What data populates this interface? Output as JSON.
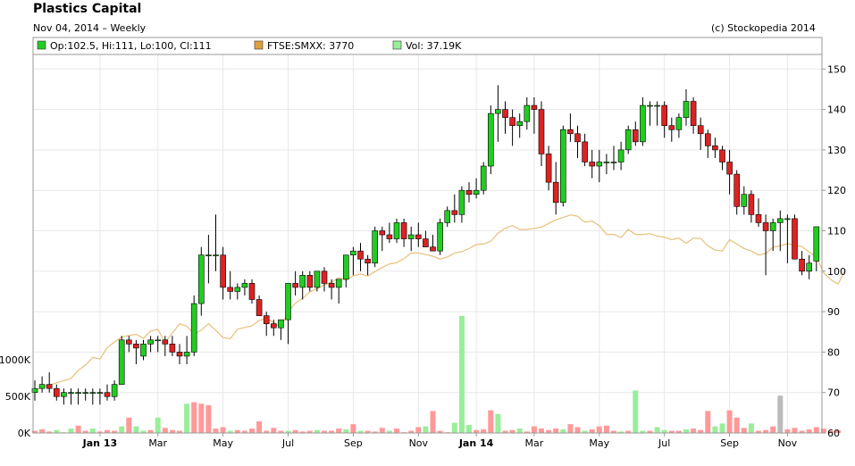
{
  "header": {
    "title": "Plastics Capital",
    "subtitle": "Nov 04, 2014 – Weekly",
    "copyright": "(c) Stockopedia 2014"
  },
  "legend": [
    {
      "label": "Op:102.5, Hi:111, Lo:100, Cl:111",
      "color": "#22cc22"
    },
    {
      "label": "FTSE:SMXX: 3770",
      "color": "#e0a040"
    },
    {
      "label": "Vol: 37.19K",
      "color": "#99ee99"
    }
  ],
  "colors": {
    "up": "#22cc22",
    "down": "#dd2222",
    "index_line": "#e8c07a",
    "volume_up": "#99ee99",
    "volume_down": "#ff9999",
    "volume_neutral": "#bbbbbb"
  },
  "chart_data": {
    "type": "candlestick",
    "price_axis": {
      "min": 60,
      "max": 150,
      "ticks": [
        60,
        70,
        80,
        90,
        100,
        110,
        120,
        130,
        140,
        150
      ]
    },
    "volume_axis": {
      "max": 1000000,
      "ticks": [
        {
          "v": 0,
          "label": "0K"
        },
        {
          "v": 500000,
          "label": "500K"
        },
        {
          "v": 1000000,
          "label": "1000K"
        }
      ]
    },
    "x_labels": [
      {
        "label": "Jan 13",
        "week": 9,
        "bold": true
      },
      {
        "label": "Mar",
        "week": 17,
        "bold": false
      },
      {
        "label": "May",
        "week": 26,
        "bold": false
      },
      {
        "label": "Jul",
        "week": 35,
        "bold": false
      },
      {
        "label": "Sep",
        "week": 44,
        "bold": false
      },
      {
        "label": "Nov",
        "week": 53,
        "bold": false
      },
      {
        "label": "Jan 14",
        "week": 61,
        "bold": true
      },
      {
        "label": "Mar",
        "week": 69,
        "bold": false
      },
      {
        "label": "May",
        "week": 78,
        "bold": false
      },
      {
        "label": "Jul",
        "week": 87,
        "bold": false
      },
      {
        "label": "Sep",
        "week": 96,
        "bold": false
      },
      {
        "label": "Nov",
        "week": 104,
        "bold": false
      }
    ],
    "candles": [
      {
        "o": 70,
        "h": 73,
        "l": 68,
        "c": 71
      },
      {
        "o": 71,
        "h": 74,
        "l": 70,
        "c": 72
      },
      {
        "o": 72,
        "h": 75,
        "l": 70,
        "c": 71
      },
      {
        "o": 71,
        "h": 72,
        "l": 68,
        "c": 69
      },
      {
        "o": 69,
        "h": 71,
        "l": 67,
        "c": 70
      },
      {
        "o": 70,
        "h": 71,
        "l": 67,
        "c": 70
      },
      {
        "o": 70,
        "h": 71,
        "l": 67,
        "c": 70
      },
      {
        "o": 70,
        "h": 71,
        "l": 68,
        "c": 70
      },
      {
        "o": 70,
        "h": 71,
        "l": 67,
        "c": 70
      },
      {
        "o": 70,
        "h": 71,
        "l": 67,
        "c": 70
      },
      {
        "o": 70,
        "h": 72,
        "l": 68,
        "c": 69
      },
      {
        "o": 69,
        "h": 73,
        "l": 68,
        "c": 72
      },
      {
        "o": 72,
        "h": 84,
        "l": 72,
        "c": 83
      },
      {
        "o": 83,
        "h": 84,
        "l": 80,
        "c": 82
      },
      {
        "o": 82,
        "h": 83,
        "l": 77,
        "c": 81
      },
      {
        "o": 79,
        "h": 83,
        "l": 78,
        "c": 82
      },
      {
        "o": 82,
        "h": 84,
        "l": 80,
        "c": 83
      },
      {
        "o": 83,
        "h": 84,
        "l": 80,
        "c": 83
      },
      {
        "o": 83,
        "h": 84,
        "l": 79,
        "c": 82
      },
      {
        "o": 82,
        "h": 84,
        "l": 79,
        "c": 80
      },
      {
        "o": 80,
        "h": 82,
        "l": 77,
        "c": 79
      },
      {
        "o": 79,
        "h": 84,
        "l": 77,
        "c": 80
      },
      {
        "o": 80,
        "h": 94,
        "l": 79,
        "c": 92
      },
      {
        "o": 92,
        "h": 106,
        "l": 89,
        "c": 104
      },
      {
        "o": 104,
        "h": 109,
        "l": 97,
        "c": 104
      },
      {
        "o": 104,
        "h": 114,
        "l": 100,
        "c": 104
      },
      {
        "o": 104,
        "h": 106,
        "l": 93,
        "c": 96
      },
      {
        "o": 96,
        "h": 100,
        "l": 93,
        "c": 95
      },
      {
        "o": 95,
        "h": 97,
        "l": 93,
        "c": 96
      },
      {
        "o": 96,
        "h": 98,
        "l": 94,
        "c": 97
      },
      {
        "o": 97,
        "h": 98,
        "l": 92,
        "c": 93
      },
      {
        "o": 93,
        "h": 94,
        "l": 89,
        "c": 89
      },
      {
        "o": 89,
        "h": 90,
        "l": 84,
        "c": 87
      },
      {
        "o": 87,
        "h": 88,
        "l": 84,
        "c": 86
      },
      {
        "o": 86,
        "h": 87,
        "l": 83,
        "c": 88
      },
      {
        "o": 88,
        "h": 97,
        "l": 82,
        "c": 97
      },
      {
        "o": 97,
        "h": 100,
        "l": 94,
        "c": 96
      },
      {
        "o": 96,
        "h": 100,
        "l": 93,
        "c": 99
      },
      {
        "o": 99,
        "h": 100,
        "l": 95,
        "c": 96
      },
      {
        "o": 96,
        "h": 100,
        "l": 95,
        "c": 100
      },
      {
        "o": 100,
        "h": 101,
        "l": 95,
        "c": 97
      },
      {
        "o": 97,
        "h": 98,
        "l": 93,
        "c": 96
      },
      {
        "o": 96,
        "h": 98,
        "l": 92,
        "c": 98
      },
      {
        "o": 98,
        "h": 104,
        "l": 96,
        "c": 104
      },
      {
        "o": 104,
        "h": 106,
        "l": 99,
        "c": 105
      },
      {
        "o": 105,
        "h": 107,
        "l": 100,
        "c": 103
      },
      {
        "o": 103,
        "h": 104,
        "l": 99,
        "c": 102
      },
      {
        "o": 102,
        "h": 111,
        "l": 101,
        "c": 110
      },
      {
        "o": 110,
        "h": 111,
        "l": 105,
        "c": 109
      },
      {
        "o": 109,
        "h": 112,
        "l": 107,
        "c": 108
      },
      {
        "o": 108,
        "h": 113,
        "l": 107,
        "c": 112
      },
      {
        "o": 112,
        "h": 113,
        "l": 106,
        "c": 108
      },
      {
        "o": 108,
        "h": 111,
        "l": 105,
        "c": 109
      },
      {
        "o": 109,
        "h": 112,
        "l": 106,
        "c": 108
      },
      {
        "o": 108,
        "h": 110,
        "l": 106,
        "c": 106
      },
      {
        "o": 106,
        "h": 109,
        "l": 105,
        "c": 105
      },
      {
        "o": 105,
        "h": 113,
        "l": 104,
        "c": 112
      },
      {
        "o": 112,
        "h": 116,
        "l": 111,
        "c": 115
      },
      {
        "o": 115,
        "h": 119,
        "l": 112,
        "c": 114
      },
      {
        "o": 114,
        "h": 121,
        "l": 112,
        "c": 120
      },
      {
        "o": 120,
        "h": 122,
        "l": 117,
        "c": 119
      },
      {
        "o": 119,
        "h": 123,
        "l": 118,
        "c": 120
      },
      {
        "o": 120,
        "h": 127,
        "l": 119,
        "c": 126
      },
      {
        "o": 126,
        "h": 141,
        "l": 124,
        "c": 139
      },
      {
        "o": 139,
        "h": 146,
        "l": 132,
        "c": 140
      },
      {
        "o": 140,
        "h": 142,
        "l": 134,
        "c": 138
      },
      {
        "o": 138,
        "h": 140,
        "l": 131,
        "c": 136
      },
      {
        "o": 136,
        "h": 139,
        "l": 133,
        "c": 137
      },
      {
        "o": 137,
        "h": 143,
        "l": 135,
        "c": 141
      },
      {
        "o": 141,
        "h": 143,
        "l": 134,
        "c": 140
      },
      {
        "o": 140,
        "h": 142,
        "l": 126,
        "c": 129
      },
      {
        "o": 129,
        "h": 131,
        "l": 120,
        "c": 122
      },
      {
        "o": 122,
        "h": 127,
        "l": 114,
        "c": 117
      },
      {
        "o": 117,
        "h": 136,
        "l": 116,
        "c": 135
      },
      {
        "o": 135,
        "h": 139,
        "l": 132,
        "c": 134
      },
      {
        "o": 134,
        "h": 136,
        "l": 128,
        "c": 132
      },
      {
        "o": 132,
        "h": 134,
        "l": 126,
        "c": 127
      },
      {
        "o": 127,
        "h": 130,
        "l": 123,
        "c": 126
      },
      {
        "o": 126,
        "h": 130,
        "l": 122,
        "c": 127
      },
      {
        "o": 127,
        "h": 129,
        "l": 124,
        "c": 127
      },
      {
        "o": 127,
        "h": 131,
        "l": 125,
        "c": 127
      },
      {
        "o": 127,
        "h": 132,
        "l": 125,
        "c": 130
      },
      {
        "o": 130,
        "h": 136,
        "l": 129,
        "c": 135
      },
      {
        "o": 135,
        "h": 137,
        "l": 131,
        "c": 132
      },
      {
        "o": 132,
        "h": 143,
        "l": 131,
        "c": 141
      },
      {
        "o": 141,
        "h": 142,
        "l": 136,
        "c": 141
      },
      {
        "o": 141,
        "h": 142,
        "l": 136,
        "c": 141
      },
      {
        "o": 141,
        "h": 142,
        "l": 133,
        "c": 136
      },
      {
        "o": 136,
        "h": 138,
        "l": 132,
        "c": 135
      },
      {
        "o": 135,
        "h": 139,
        "l": 133,
        "c": 138
      },
      {
        "o": 138,
        "h": 145,
        "l": 136,
        "c": 142
      },
      {
        "o": 142,
        "h": 143,
        "l": 134,
        "c": 136
      },
      {
        "o": 136,
        "h": 138,
        "l": 130,
        "c": 134
      },
      {
        "o": 134,
        "h": 135,
        "l": 128,
        "c": 131
      },
      {
        "o": 131,
        "h": 133,
        "l": 128,
        "c": 130
      },
      {
        "o": 130,
        "h": 131,
        "l": 125,
        "c": 127
      },
      {
        "o": 127,
        "h": 130,
        "l": 119,
        "c": 124
      },
      {
        "o": 124,
        "h": 125,
        "l": 114,
        "c": 116
      },
      {
        "o": 116,
        "h": 121,
        "l": 114,
        "c": 119
      },
      {
        "o": 119,
        "h": 120,
        "l": 112,
        "c": 114
      },
      {
        "o": 114,
        "h": 118,
        "l": 111,
        "c": 112
      },
      {
        "o": 112,
        "h": 114,
        "l": 99,
        "c": 110
      },
      {
        "o": 110,
        "h": 113,
        "l": 105,
        "c": 112
      },
      {
        "o": 112,
        "h": 115,
        "l": 105,
        "c": 113
      },
      {
        "o": 113,
        "h": 114,
        "l": 102,
        "c": 113
      },
      {
        "o": 113,
        "h": 114,
        "l": 104,
        "c": 103
      },
      {
        "o": 103,
        "h": 105,
        "l": 99,
        "c": 100
      },
      {
        "o": 100,
        "h": 104,
        "l": 98,
        "c": 102
      },
      {
        "o": 102.5,
        "h": 111,
        "l": 100,
        "c": 111
      }
    ],
    "volumes": [
      30000,
      50000,
      20000,
      40000,
      10000,
      60000,
      100000,
      30000,
      60000,
      20000,
      40000,
      30000,
      90000,
      210000,
      90000,
      30000,
      40000,
      210000,
      70000,
      40000,
      30000,
      400000,
      420000,
      400000,
      380000,
      60000,
      80000,
      30000,
      40000,
      30000,
      60000,
      160000,
      30000,
      70000,
      30000,
      30000,
      40000,
      20000,
      30000,
      40000,
      30000,
      30000,
      60000,
      50000,
      120000,
      30000,
      30000,
      20000,
      70000,
      30000,
      60000,
      10000,
      30000,
      80000,
      90000,
      300000,
      30000,
      10000,
      140000,
      1600000,
      110000,
      40000,
      50000,
      310000,
      260000,
      30000,
      40000,
      60000,
      20000,
      90000,
      60000,
      40000,
      60000,
      50000,
      120000,
      80000,
      30000,
      50000,
      90000,
      100000,
      30000,
      20000,
      30000,
      580000,
      30000,
      30000,
      80000,
      40000,
      30000,
      30000,
      50000,
      60000,
      40000,
      300000,
      90000,
      130000,
      310000,
      210000,
      70000,
      130000,
      30000,
      40000,
      90000,
      510000,
      50000,
      70000,
      30000,
      50000,
      80000,
      60000,
      30000,
      37190
    ],
    "volume_flags": "ddduuudduddduduududddudddddudddddddudddudddududddudddduddduuudddudduddddduddudddduduuduudduddduudddudddndddddddduddddud",
    "index_line": [
      70.3,
      71.5,
      71.8,
      72.4,
      72.9,
      73.5,
      75.5,
      76.8,
      78.7,
      78.3,
      81.1,
      82.5,
      83.7,
      84.1,
      84.4,
      83.4,
      85.2,
      85.6,
      82.4,
      84.7,
      87.0,
      86.4,
      84.5,
      85.4,
      87.0,
      85.4,
      83.6,
      83.3,
      85.7,
      86.1,
      86.5,
      87.8,
      88.3,
      87.3,
      86.1,
      90.0,
      92.1,
      93.3,
      94.9,
      95.7,
      96.6,
      97.3,
      98.4,
      97.8,
      98.9,
      99.3,
      98.8,
      99.9,
      100.9,
      101.8,
      102.1,
      103.1,
      104.5,
      104.5,
      104.1,
      103.7,
      103.0,
      103.5,
      104.5,
      104.8,
      105.6,
      106.6,
      106.7,
      107.4,
      109.4,
      110.6,
      111.3,
      110.3,
      110.3,
      110.6,
      110.9,
      111.8,
      112.7,
      113.3,
      113.9,
      113.6,
      112.1,
      112.4,
      111.3,
      109.1,
      109.1,
      108.3,
      110.3,
      109.1,
      109.1,
      109.3,
      108.7,
      108.4,
      107.8,
      108.2,
      106.9,
      108.2,
      108.1,
      106.3,
      105.2,
      105.0,
      107.8,
      106.7,
      105.6,
      105.0,
      104.0,
      104.4,
      105.9,
      106.3,
      106.8,
      106.5,
      106.1,
      104.7,
      103.6,
      99.6,
      97.9,
      96.8,
      100.5
    ]
  }
}
